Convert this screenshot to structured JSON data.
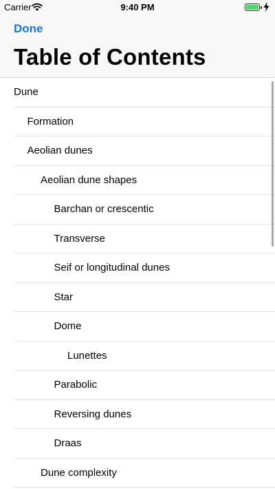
{
  "status_bar": {
    "carrier": "Carrier",
    "time": "9:40 PM",
    "battery_level_percent": 100,
    "battery_color": "#4cd964"
  },
  "nav": {
    "done_label": "Done",
    "title": "Table of Contents",
    "accent_color": "#1a76d2"
  },
  "toc": [
    {
      "label": "Dune",
      "level": 0
    },
    {
      "label": "Formation",
      "level": 1
    },
    {
      "label": "Aeolian dunes",
      "level": 1
    },
    {
      "label": "Aeolian dune shapes",
      "level": 2
    },
    {
      "label": "Barchan or crescentic",
      "level": 3
    },
    {
      "label": "Transverse",
      "level": 3
    },
    {
      "label": "Seif or longitudinal dunes",
      "level": 3
    },
    {
      "label": "Star",
      "level": 3
    },
    {
      "label": "Dome",
      "level": 3
    },
    {
      "label": "Lunettes",
      "level": 4
    },
    {
      "label": "Parabolic",
      "level": 3
    },
    {
      "label": "Reversing dunes",
      "level": 3
    },
    {
      "label": "Draas",
      "level": 3
    },
    {
      "label": "Dune complexity",
      "level": 2
    }
  ]
}
